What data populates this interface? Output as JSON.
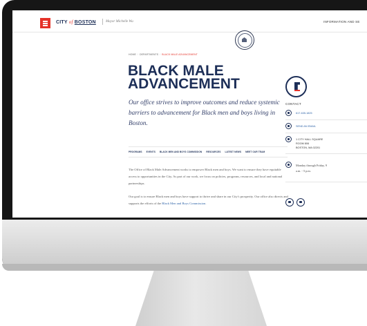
{
  "header": {
    "logo_city": "CITY",
    "logo_of": "of",
    "logo_boston": "BOSTON",
    "mayor": "Mayor Michelle Wu",
    "nav_right": "INFORMATION AND SE"
  },
  "breadcrumb": {
    "home": "HOME",
    "departments": "DEPARTMENTS",
    "current": "BLACK MALE ADVANCEMENT"
  },
  "page": {
    "title": "BLACK MALE ADVANCEMENT",
    "intro": "Our office strives to improve outcomes and reduce systemic barriers to advancement for Black men and boys living in Boston."
  },
  "subnav": [
    "PROGRAMS",
    "EVENTS",
    "BLACK MEN AND BOYS COMMISSION",
    "RESOURCES",
    "LATEST NEWS",
    "MEET OUR TEAM"
  ],
  "body": {
    "p1": "The Office of Black Male Advancement works to empower Black men and boys. We want to ensure they have equitable access to opportunities in the City. As part of our work, we focus on policies, programs, resources, and local and national partnerships.",
    "p2_start": "Our goal is to ensure Black men and boys have support to thrive and share in our City's prosperity. Our office also directs and supports the efforts of the ",
    "p2_link": "Black Men and Boys Commission",
    "p2_end": "."
  },
  "contact": {
    "label": "CONTACT",
    "phone": "617-635-1825",
    "email": "SEND AN EMAIL",
    "address_line1": "1 CITY HALL SQUARE",
    "address_line2": "ROOM 806",
    "address_line3": "BOSTON, MA 02201",
    "hours_line1": "Monday through Friday, 9",
    "hours_line2": "a.m. - 5 p.m."
  },
  "icons": [
    "menu-icon",
    "city-seal-icon",
    "department-logo-icon",
    "phone-icon",
    "email-icon",
    "location-icon",
    "clock-icon",
    "twitter-icon",
    "instagram-icon"
  ],
  "colors": {
    "brand_navy": "#1c2e57",
    "brand_red": "#e5332a",
    "link_blue": "#2f64a8"
  }
}
